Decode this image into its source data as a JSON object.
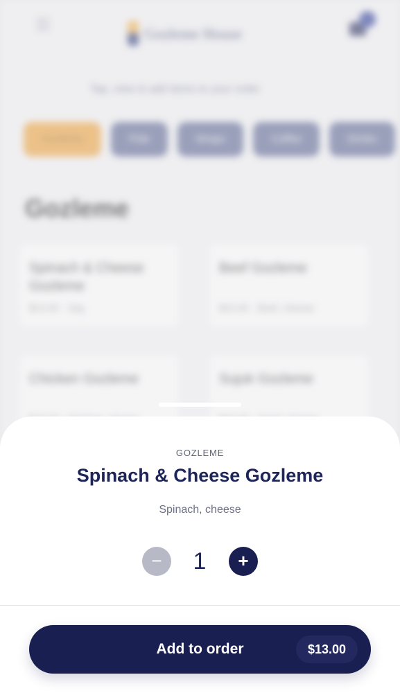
{
  "background": {
    "header": {
      "menu_icon": "hamburger-menu-icon",
      "brand_name": "Gozleme House",
      "cart_icon": "shopping-basket-icon"
    },
    "notice": "Tap, view & add items to your order",
    "categories": [
      "Gozleme",
      "Pide",
      "Wraps",
      "Coffee",
      "Drinks"
    ],
    "section_title": "Gozleme",
    "cards": [
      {
        "name": "Spinach & Cheese Gozleme",
        "meta": "$13.00 · Veg"
      },
      {
        "name": "Beef Gozleme",
        "meta": "$15.00 · Beef, cheese"
      },
      {
        "name": "Chicken Gozleme",
        "meta": "$15.00 · Chicken, cheese"
      },
      {
        "name": "Sujuk Gozleme",
        "meta": "$15.00 · Sujuk, cheese"
      }
    ]
  },
  "sheet": {
    "category": "GOZLEME",
    "title": "Spinach & Cheese Gozleme",
    "description": "Spinach, cheese",
    "quantity": {
      "minus_symbol": "−",
      "value": "1",
      "plus_symbol": "+"
    },
    "add_button": {
      "label": "Add to order",
      "price": "$13.00"
    }
  },
  "colors": {
    "primary": "#1a1f52",
    "accent": "#f0a33a",
    "disabled": "#b7b9c7"
  }
}
